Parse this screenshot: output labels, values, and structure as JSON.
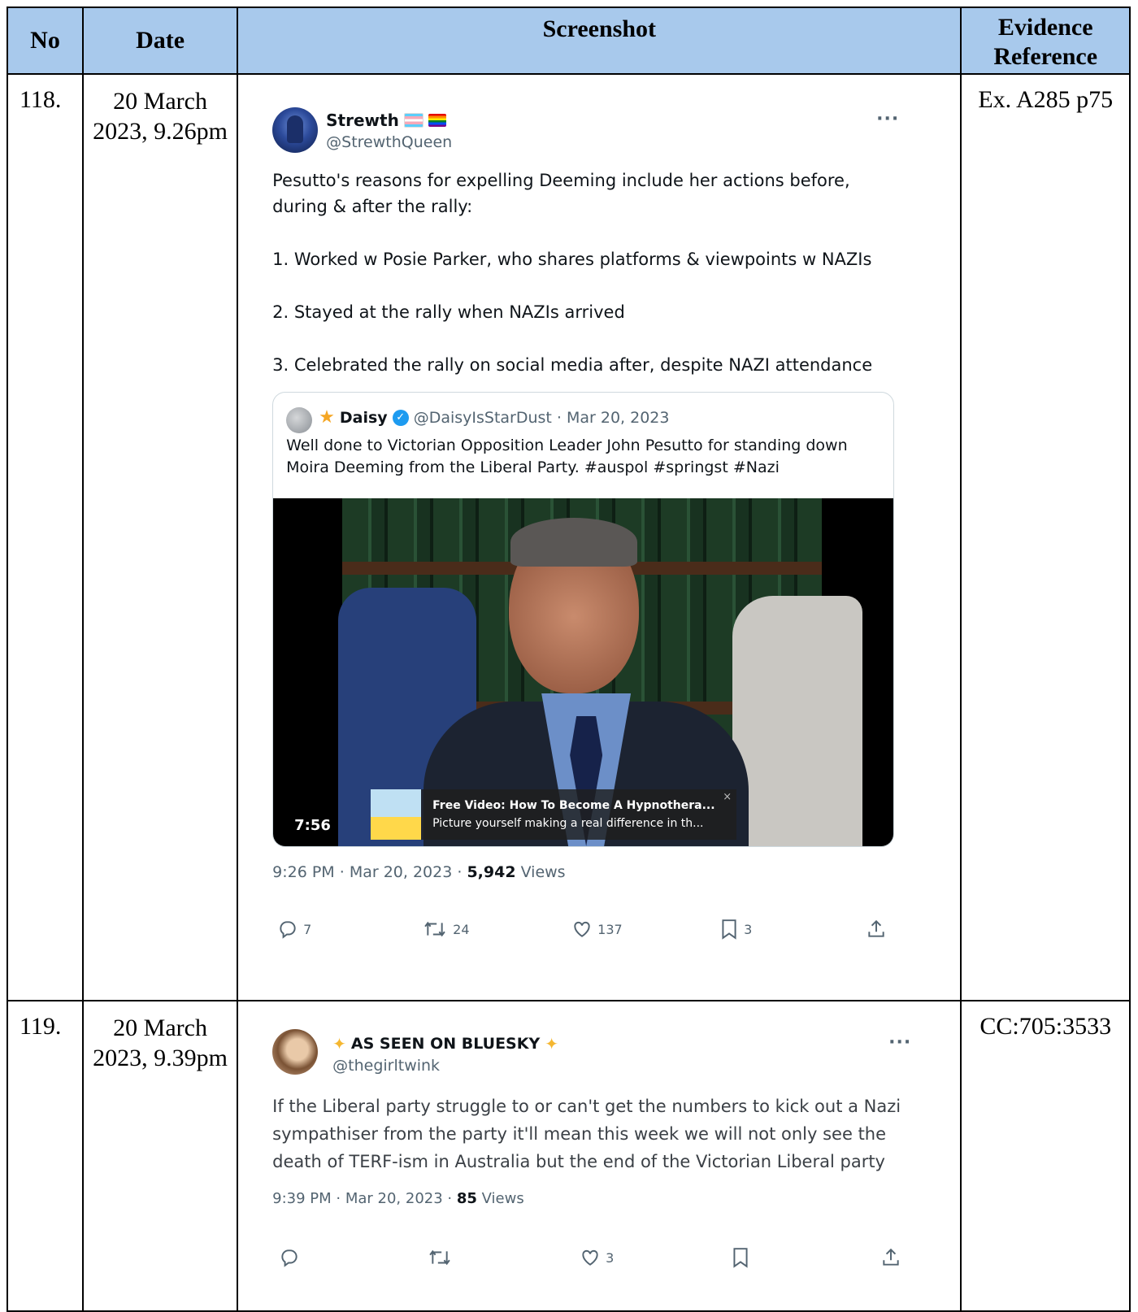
{
  "headers": {
    "no": "No",
    "date": "Date",
    "screenshot": "Screenshot",
    "evidence": "Evidence Reference"
  },
  "rows": [
    {
      "no": "118.",
      "date": "20 March 2023, 9.26pm",
      "ref": "Ex. A285 p75",
      "tweet": {
        "name": "Strewth",
        "handle": "@StrewthQueen",
        "more": "···",
        "paragraphs": [
          "Pesutto's reasons for expelling Deeming include her actions before, during & after the rally:",
          "1. Worked w Posie Parker, who shares platforms & viewpoints w NAZIs",
          "2. Stayed at the rally when NAZIs arrived",
          "3. Celebrated the rally on social media after, despite NAZI attendance"
        ],
        "quote": {
          "star": "★",
          "name": "Daisy",
          "meta": "@DaisyIsStarDust · Mar 20, 2023",
          "text": "Well done to Victorian Opposition Leader John Pesutto for standing down Moira Deeming from the Liberal Party. #auspol #springst #Nazi",
          "video_duration": "7:56",
          "ad_title": "Free Video: How To Become A Hypnothera...",
          "ad_sub": "Picture yourself making a real difference in th...",
          "ad_close": "×"
        },
        "time": "9:26 PM · Mar 20, 2023 · ",
        "views_count": "5,942",
        "views_label": " Views",
        "replies": "7",
        "reposts": "24",
        "likes": "137",
        "bookmarks": "3"
      }
    },
    {
      "no": "119.",
      "date": "20 March 2023, 9.39pm",
      "ref": "CC:705:3533",
      "tweet": {
        "name": "AS SEEN ON BLUESKY",
        "star": "✦",
        "handle": "@thegirltwink",
        "more": "···",
        "text": "If the Liberal party struggle to or can't get the numbers to kick out a Nazi sympathiser from the party it'll mean this week we will not only see the death of TERF-ism in Australia but the end of the Victorian Liberal party",
        "time": "9:39 PM · Mar 20, 2023 · ",
        "views_count": "85",
        "views_label": " Views",
        "likes": "3"
      }
    }
  ],
  "colors": {
    "header_bg": "#a8c9ec",
    "twitter_gray": "#536471",
    "twitter_blue": "#1d9bf0"
  }
}
